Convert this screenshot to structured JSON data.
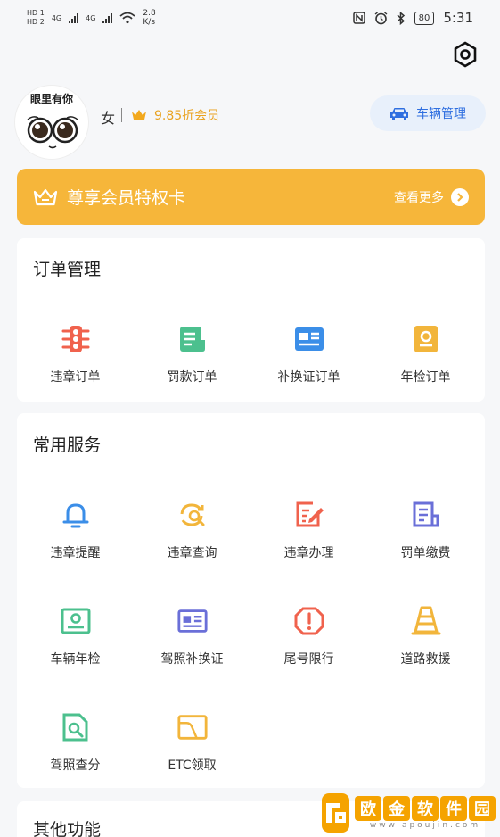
{
  "status_bar": {
    "hd1": "HD 1",
    "hd2": "HD 2",
    "net1": "4G",
    "net2": "4G",
    "speed_value": "2.8",
    "speed_unit": "K/s",
    "battery": "80",
    "time": "5:31"
  },
  "profile": {
    "avatar_text": "眼里有你",
    "gender": "女",
    "member_level": "9.85折会员",
    "vehicle_button": "车辆管理"
  },
  "vip_card": {
    "title": "尊享会员特权卡",
    "more": "查看更多"
  },
  "orders": {
    "title": "订单管理",
    "items": [
      {
        "label": "违章订单",
        "icon": "traffic-light-icon",
        "color": "#f0624d"
      },
      {
        "label": "罚款订单",
        "icon": "receipt-icon",
        "color": "#4cc08e"
      },
      {
        "label": "补换证订单",
        "icon": "id-card-icon",
        "color": "#3b8ee8"
      },
      {
        "label": "年检订单",
        "icon": "inspection-badge-icon",
        "color": "#f2b53b"
      }
    ]
  },
  "services": {
    "title": "常用服务",
    "items": [
      {
        "label": "违章提醒",
        "icon": "bell-icon",
        "color": "#3b8ee8"
      },
      {
        "label": "违章查询",
        "icon": "refresh-search-icon",
        "color": "#f2b53b"
      },
      {
        "label": "违章办理",
        "icon": "edit-document-icon",
        "color": "#f0624d"
      },
      {
        "label": "罚单缴费",
        "icon": "ticket-document-icon",
        "color": "#6a6fd8"
      },
      {
        "label": "车辆年检",
        "icon": "vehicle-inspection-icon",
        "color": "#4cc08e"
      },
      {
        "label": "驾照补换证",
        "icon": "license-card-icon",
        "color": "#6a6fd8"
      },
      {
        "label": "尾号限行",
        "icon": "warning-octagon-icon",
        "color": "#f0624d"
      },
      {
        "label": "道路救援",
        "icon": "traffic-cone-icon",
        "color": "#f2b53b"
      },
      {
        "label": "驾照查分",
        "icon": "license-search-icon",
        "color": "#4cc08e"
      },
      {
        "label": "ETC领取",
        "icon": "etc-card-icon",
        "color": "#f2b53b"
      }
    ]
  },
  "other": {
    "title": "其他功能"
  },
  "watermark": {
    "chars": [
      "欧",
      "金",
      "软",
      "件",
      "园"
    ],
    "url": "www.apoujin.com"
  }
}
